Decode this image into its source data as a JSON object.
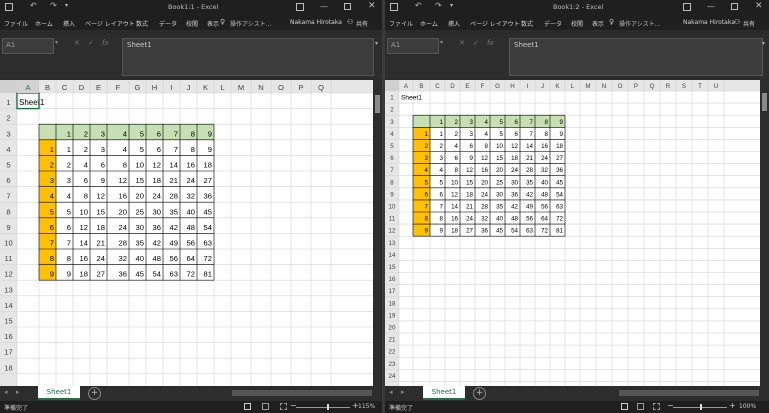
{
  "windows": [
    {
      "id": "left",
      "title": "Book1:1 - Excel",
      "search_hint": "操作アシスト...",
      "user": "Nakama Hirotaka",
      "share_label": "共有",
      "menu": [
        "ファイル",
        "ホーム",
        "挿入",
        "ページ レイアウト",
        "数式",
        "データ",
        "校閲",
        "表示"
      ],
      "name_box": "A1",
      "formula": "Sheet1",
      "sheet_tab": "Sheet1",
      "status": "準備完了",
      "zoom": "115%",
      "zoom_fraction": 0.57
    },
    {
      "id": "right",
      "title": "Book1:2 - Excel",
      "search_hint": "操作アシスト...",
      "user": "Nakama Hirotaka",
      "share_label": "共有",
      "menu": [
        "ファイル",
        "ホーム",
        "挿入",
        "ページ レイアウト",
        "数式",
        "データ",
        "校閲",
        "表示"
      ],
      "name_box": "A1",
      "formula": "Sheet1",
      "sheet_tab": "Sheet1",
      "status": "準備完了",
      "zoom": "100%",
      "zoom_fraction": 0.5
    }
  ],
  "sheet": {
    "columns": [
      "A",
      "B",
      "C",
      "D",
      "E",
      "F",
      "G",
      "H",
      "I",
      "J",
      "K",
      "L",
      "M",
      "N",
      "O",
      "P",
      "Q",
      "R",
      "S",
      "T",
      "U"
    ],
    "cell_a1": "Sheet1",
    "header_numbers": [
      1,
      2,
      3,
      4,
      5,
      6,
      7,
      8,
      9
    ],
    "row_numbers": [
      1,
      2,
      3,
      4,
      5,
      6,
      7,
      8,
      9
    ],
    "grid": [
      [
        1,
        2,
        3,
        4,
        5,
        6,
        7,
        8,
        9
      ],
      [
        2,
        4,
        6,
        8,
        10,
        12,
        14,
        16,
        18
      ],
      [
        3,
        6,
        9,
        12,
        15,
        18,
        21,
        24,
        27
      ],
      [
        4,
        8,
        12,
        16,
        20,
        24,
        28,
        32,
        36
      ],
      [
        5,
        10,
        15,
        20,
        25,
        30,
        35,
        40,
        45
      ],
      [
        6,
        12,
        18,
        24,
        30,
        36,
        42,
        48,
        54
      ],
      [
        7,
        14,
        21,
        28,
        35,
        42,
        49,
        56,
        63
      ],
      [
        8,
        16,
        24,
        32,
        40,
        48,
        56,
        64,
        72
      ],
      [
        9,
        18,
        27,
        36,
        45,
        54,
        63,
        72,
        81
      ]
    ]
  },
  "colors": {
    "header_fill": "#c6e0b4",
    "row_fill": "#ffc000",
    "selection": "#217346",
    "grid_line": "#d4d4d4",
    "table_line": "#000000"
  }
}
